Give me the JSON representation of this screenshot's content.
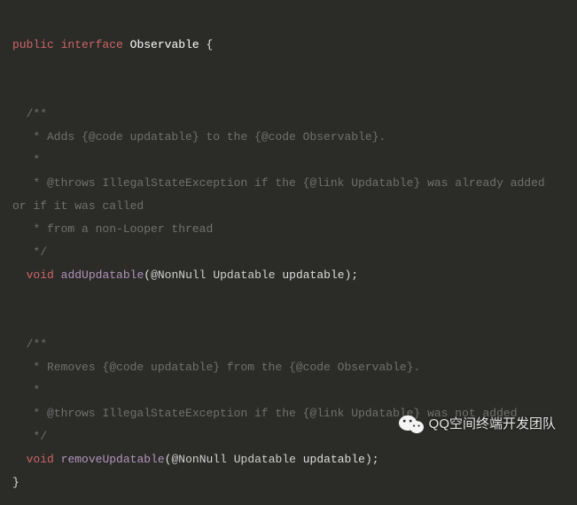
{
  "code": {
    "line1_kw1": "public",
    "line1_kw2": "interface",
    "line1_type": "Observable",
    "line1_brace": "{",
    "doc1_open": "  /**",
    "doc1_l1": "   * Adds {@code updatable} to the {@code Observable}.",
    "doc1_l2": "   *",
    "doc1_l3": "   * @throws IllegalStateException if the {@link Updatable} was already added or if it was called",
    "doc1_l4": "   * from a non-Looper thread",
    "doc1_close": "   */",
    "m1_kw": "void",
    "m1_name": "addUpdatable",
    "m1_paren_open": "(",
    "m1_anno": "@NonNull",
    "m1_ptype": "Updatable",
    "m1_pname": "updatable",
    "m1_paren_close_semi": ");",
    "doc2_open": "  /**",
    "doc2_l1": "   * Removes {@code updatable} from the {@code Observable}.",
    "doc2_l2": "   *",
    "doc2_l3": "   * @throws IllegalStateException if the {@link Updatable} was not added",
    "doc2_close": "   */",
    "m2_kw": "void",
    "m2_name": "removeUpdatable",
    "m2_paren_open": "(",
    "m2_anno": "@NonNull",
    "m2_ptype": "Updatable",
    "m2_pname": "updatable",
    "m2_paren_close_semi": ");",
    "close_brace": "}"
  },
  "watermark_text": "QQ空间终端开发团队"
}
